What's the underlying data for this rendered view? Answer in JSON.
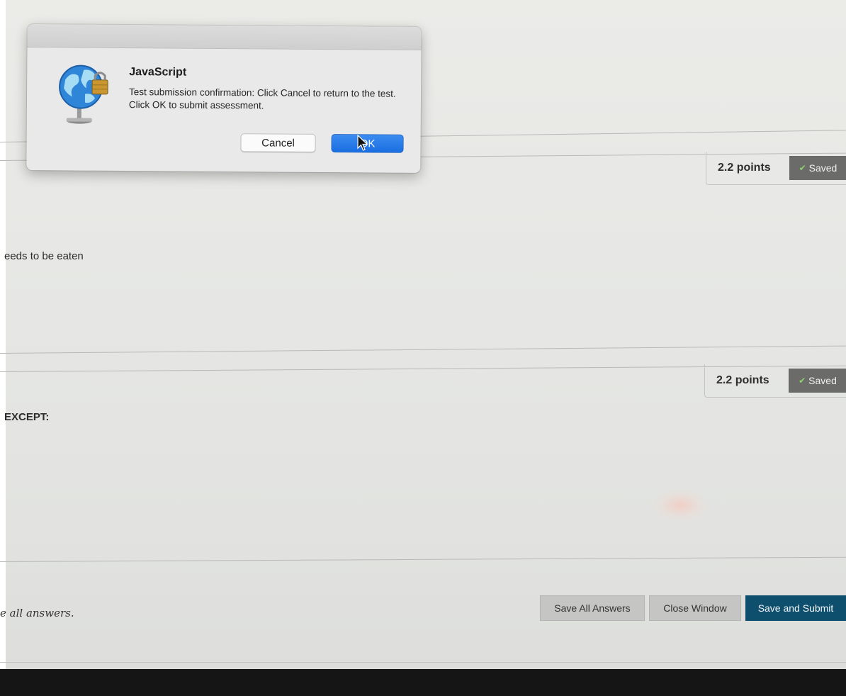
{
  "dialog": {
    "title": "JavaScript",
    "message": "Test submission confirmation: Click Cancel to return to the test. Click OK to submit assessment.",
    "cancel_label": "Cancel",
    "ok_label": "OK"
  },
  "questions": [
    {
      "points": "2.2 points",
      "saved_label": "Saved",
      "text": "eeds to be eaten"
    },
    {
      "points": "2.2 points",
      "saved_label": "Saved",
      "text": "EXCEPT:"
    }
  ],
  "footer": {
    "note": "e all answers.",
    "save_all_label": "Save All Answers",
    "close_label": "Close Window",
    "submit_label": "Save and Submit"
  },
  "colors": {
    "primary_button": "#0f4f6e",
    "ok_button": "#1a6ee0",
    "saved_badge": "#6b6c6a"
  }
}
